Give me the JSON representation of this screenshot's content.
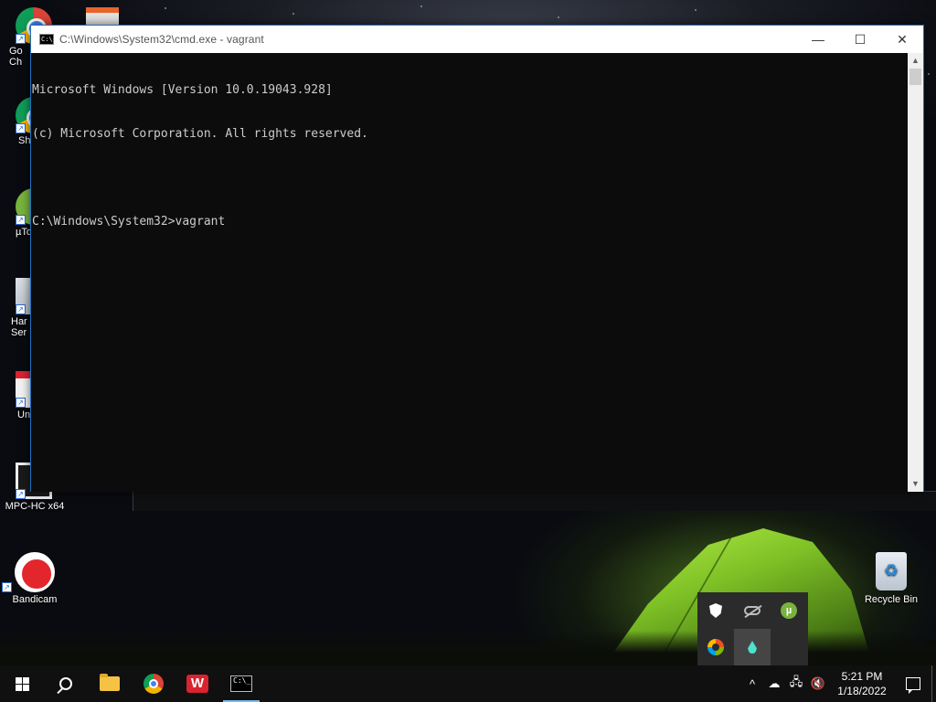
{
  "window": {
    "title": "C:\\Windows\\System32\\cmd.exe - vagrant",
    "app_icon_text": "C:\\",
    "minimize_glyph": "—",
    "maximize_glyph": "☐",
    "close_glyph": "✕"
  },
  "console": {
    "lines": [
      "Microsoft Windows [Version 10.0.19043.928]",
      "(c) Microsoft Corporation. All rights reserved.",
      "",
      "C:\\Windows\\System32>vagrant"
    ],
    "scroll_up_glyph": "▲",
    "scroll_down_glyph": "▼"
  },
  "desktop": {
    "icons": [
      {
        "label": "Go Ch",
        "icon": "google-chrome-icon"
      },
      {
        "label": "Sh",
        "icon": "chrome-shortcut-icon"
      },
      {
        "label": "µTo",
        "icon": "utorrent-icon"
      },
      {
        "label": "Har Ser",
        "icon": "hard-drive-icon"
      },
      {
        "label": "Un",
        "icon": "uninstaller-icon"
      },
      {
        "label": "MPC-HC x64",
        "icon": "mpc-hc-icon"
      },
      {
        "label": "Bandicam",
        "icon": "bandicam-record-icon"
      },
      {
        "label": "Recycle Bin",
        "icon": "recycle-bin-icon"
      }
    ]
  },
  "tray_flyout": {
    "items": [
      "shield-warning-icon",
      "cloud-off-icon",
      "utorrent-tray-icon",
      "edge-tray-icon",
      "droplet-tray-icon"
    ]
  },
  "taskbar": {
    "apps": [
      "start-icon",
      "search-icon",
      "file-explorer-icon",
      "chrome-icon",
      "wps-office-icon",
      "cmd-icon"
    ],
    "wps_letter": "W",
    "cmd_text": "C:\\_",
    "tray": {
      "chevron": "^",
      "time": "5:21 PM",
      "date": "1/18/2022"
    }
  },
  "colors": {
    "console_bg": "#0c0c0c",
    "console_text": "#cccccc",
    "taskbar_bg": "#101010",
    "window_border": "#1f6fbf"
  }
}
